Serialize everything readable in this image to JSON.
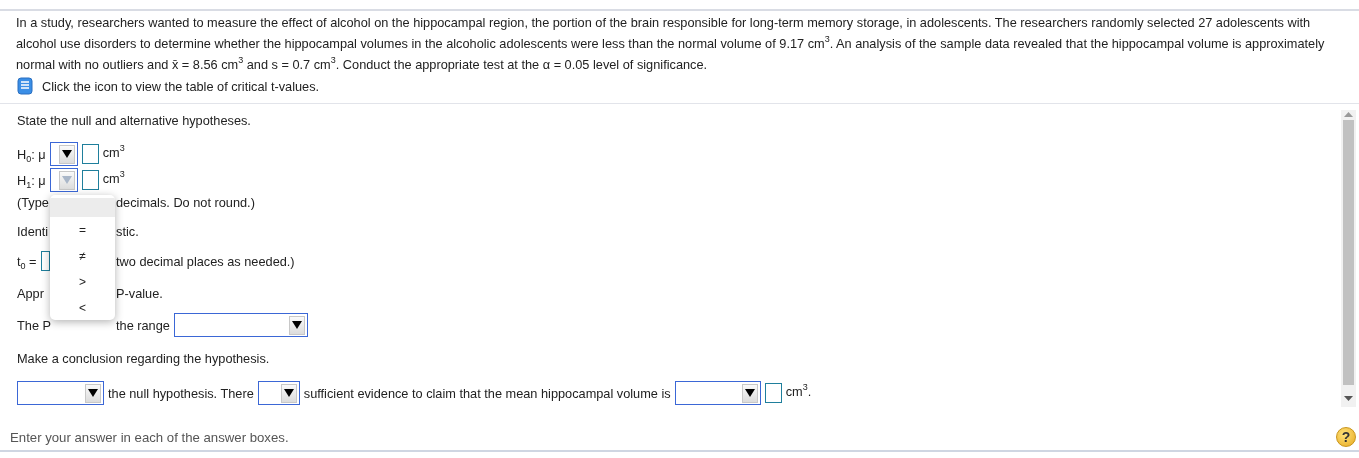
{
  "problem": {
    "paragraph": "In a study, researchers wanted to measure the effect of alcohol on the hippocampal region, the portion of the brain responsible for long-term memory storage, in adolescents. The researchers randomly selected 27 adolescents with alcohol use disorders to determine whether the hippocampal volumes in the alcoholic adolescents were less than the normal volume of 9.17 cm$^{3}$. An analysis of the sample data revealed that the hippocampal volume is approximately normal with no outliers and x̄ = 8.56 cm$^{3}$ and s = 0.7 cm$^{3}$. Conduct the appropriate test at the α = 0.05 level of significance.",
    "table_link": "Click the icon to view the table of critical t-values."
  },
  "question": {
    "prompt": "State the null and alternative hypotheses.",
    "hypotheses": [
      {
        "label": "H$_{0}$: μ",
        "open": false,
        "unit": "cm$^{3}$"
      },
      {
        "label": "H$_{1}$: μ",
        "open": true,
        "unit": "cm$^{3}$"
      }
    ],
    "lines": [
      {
        "kind": "text",
        "left": "(Type",
        "right": "decimals. Do not round.)"
      },
      {
        "kind": "text",
        "left": "Identi",
        "right": "stic."
      },
      {
        "kind": "field",
        "left": "t$_{0}$ =",
        "right": "two decimal places as needed.)"
      },
      {
        "kind": "text",
        "left": "Appr",
        "right": "P-value."
      },
      {
        "kind": "dropdown",
        "left": "The P",
        "right": "the range"
      }
    ],
    "conclusion_prompt": "Make a conclusion regarding the hypothesis.",
    "conclusion": {
      "text_1": "the null hypothesis. There",
      "text_2": "sufficient evidence to claim that the mean hippocampal volume is",
      "unit": "cm$^{3}$."
    },
    "dropdown_menu": {
      "blank_highlighted": true,
      "options": [
        "=",
        "≠",
        ">",
        "<"
      ]
    }
  },
  "status_bar": {
    "text": "Enter your answer in each of the answer boxes.",
    "help": "?"
  }
}
